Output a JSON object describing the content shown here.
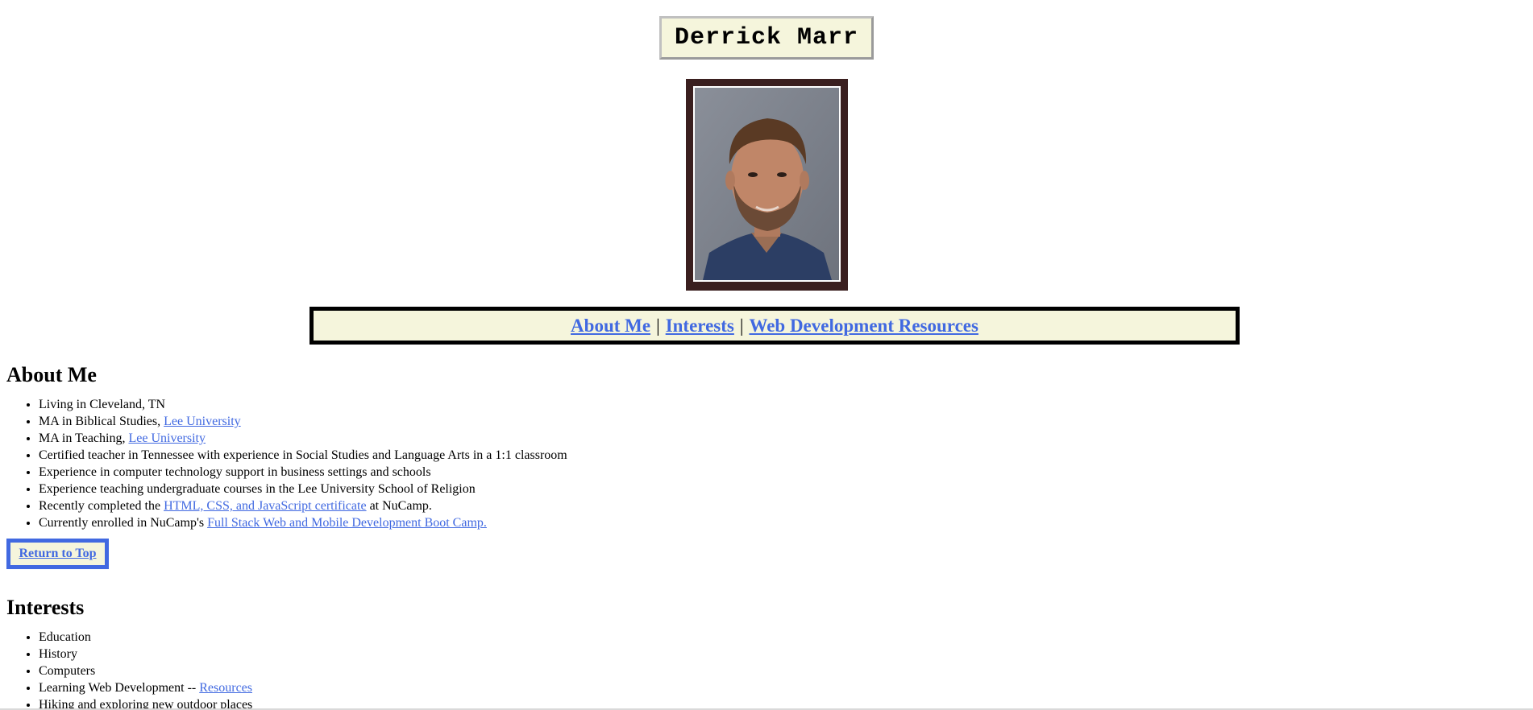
{
  "header": {
    "name": "Derrick Marr"
  },
  "nav": {
    "links": [
      {
        "label": "About Me"
      },
      {
        "label": "Interests"
      },
      {
        "label": "Web Development Resources"
      }
    ],
    "separator": "|"
  },
  "about": {
    "heading": "About Me",
    "items": [
      {
        "text": "Living in Cleveland, TN"
      },
      {
        "pre": "MA in Biblical Studies, ",
        "link": "Lee University",
        "post": ""
      },
      {
        "pre": "MA in Teaching, ",
        "link": "Lee University",
        "post": ""
      },
      {
        "text": "Certified teacher in Tennessee with experience in Social Studies and Language Arts in a 1:1 classroom"
      },
      {
        "text": "Experience in computer technology support in business settings and schools"
      },
      {
        "text": "Experience teaching undergraduate courses in the Lee University School of Religion"
      },
      {
        "pre": "Recently completed the ",
        "link": "HTML, CSS, and JavaScript certificate",
        "post": " at NuCamp."
      },
      {
        "pre": "Currently enrolled in NuCamp's ",
        "link": "Full Stack Web and Mobile Development Boot Camp.",
        "post": ""
      }
    ],
    "return_label": "Return to Top"
  },
  "interests": {
    "heading": "Interests",
    "items": [
      {
        "text": "Education"
      },
      {
        "text": "History"
      },
      {
        "text": "Computers"
      },
      {
        "pre": "Learning Web Development -- ",
        "link": "Resources",
        "post": ""
      },
      {
        "text": "Hiking and exploring new outdoor places"
      }
    ]
  },
  "colors": {
    "link": "#4169e1",
    "beige": "#f5f5dc",
    "frame": "#3a1f1f"
  }
}
